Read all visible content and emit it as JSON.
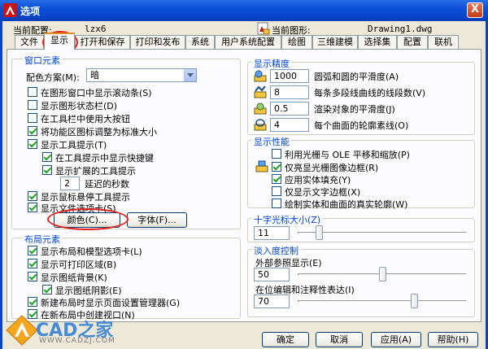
{
  "window": {
    "title": "选项",
    "close_label": "X"
  },
  "profile": {
    "current_profile_label": "当前配置:",
    "current_profile_value": "lzx6",
    "current_drawing_label": "当前图形:",
    "current_drawing_value": "Drawing1.dwg"
  },
  "tabs": [
    {
      "label": "文件"
    },
    {
      "label": "显示",
      "active": true
    },
    {
      "label": "打开和保存"
    },
    {
      "label": "打印和发布"
    },
    {
      "label": "系统"
    },
    {
      "label": "用户系统配置"
    },
    {
      "label": "绘图"
    },
    {
      "label": "三维建模"
    },
    {
      "label": "选择集"
    },
    {
      "label": "配置"
    },
    {
      "label": "联机"
    }
  ],
  "window_elements": {
    "title": "窗口元素",
    "color_scheme_label": "配色方案(M):",
    "color_scheme_value": "暗",
    "options": [
      {
        "label": "在图形窗口中显示滚动条(S)",
        "checked": false
      },
      {
        "label": "显示图形状态栏(D)",
        "checked": false
      },
      {
        "label": "在工具栏中使用大按钮",
        "checked": false
      },
      {
        "label": "将功能区图标调整为标准大小",
        "checked": true
      },
      {
        "label": "显示工具提示(T)",
        "checked": true
      },
      {
        "label": "在工具提示中显示快捷键",
        "checked": true
      },
      {
        "label": "显示扩展的工具提示",
        "checked": true
      },
      {
        "label": "显示鼠标悬停工具提示",
        "checked": true
      },
      {
        "label": "显示文件选项卡(S)",
        "checked": true
      }
    ],
    "delay_value": "2",
    "delay_label": "延迟的秒数",
    "colors_button": "颜色(C)...",
    "fonts_button": "字体(F)..."
  },
  "layout_elements": {
    "title": "布局元素",
    "options": [
      {
        "label": "显示布局和模型选项卡(L)",
        "checked": true
      },
      {
        "label": "显示可打印区域(B)",
        "checked": true
      },
      {
        "label": "显示图纸背景(K)",
        "checked": true
      },
      {
        "label": "显示图纸阴影(E)",
        "checked": true
      },
      {
        "label": "新建布局时显示页面设置管理器(G)",
        "checked": true
      },
      {
        "label": "在新布局中创建视口(N)",
        "checked": true
      }
    ]
  },
  "display_resolution": {
    "title": "显示精度",
    "rows": [
      {
        "value": "1000",
        "label": "圆弧和圆的平滑度(A)"
      },
      {
        "value": "8",
        "label": "每条多段线曲线的线段数(V)"
      },
      {
        "value": "0.5",
        "label": "渲染对象的平滑度(J)"
      },
      {
        "value": "4",
        "label": "每个曲面的轮廓素线(O)"
      }
    ]
  },
  "display_performance": {
    "title": "显示性能",
    "options": [
      {
        "label": "利用光栅与 OLE 平移和缩放(P)",
        "checked": false
      },
      {
        "label": "仅亮显光栅图像边框(R)",
        "checked": true
      },
      {
        "label": "应用实体填充(Y)",
        "checked": true
      },
      {
        "label": "仅显示文字边框(X)",
        "checked": false
      },
      {
        "label": "绘制实体和曲面的真实轮廓(W)",
        "checked": false
      }
    ]
  },
  "crosshair": {
    "title": "十字光标大小(Z)",
    "value": "11",
    "fraction": 0.11
  },
  "fade_control": {
    "title": "淡入度控制",
    "xref_label": "外部参照显示(E)",
    "xref_value": "50",
    "xref_fraction": 0.5,
    "inplace_label": "在位编辑和注释性表达(I)",
    "inplace_value": "70",
    "inplace_fraction": 0.7
  },
  "dialog_buttons": {
    "ok": "确定",
    "cancel": "取消",
    "apply": "应用(A)",
    "help": "帮助(H)"
  },
  "watermark": {
    "text": "CAD之家",
    "url": "WWW.CADZJ.COM"
  },
  "colors": {
    "title_bar": "#0a4fd6",
    "group_title": "#0046d5",
    "annotation_red": "#e0201b",
    "active_tab_accent": "#e68b2c"
  }
}
